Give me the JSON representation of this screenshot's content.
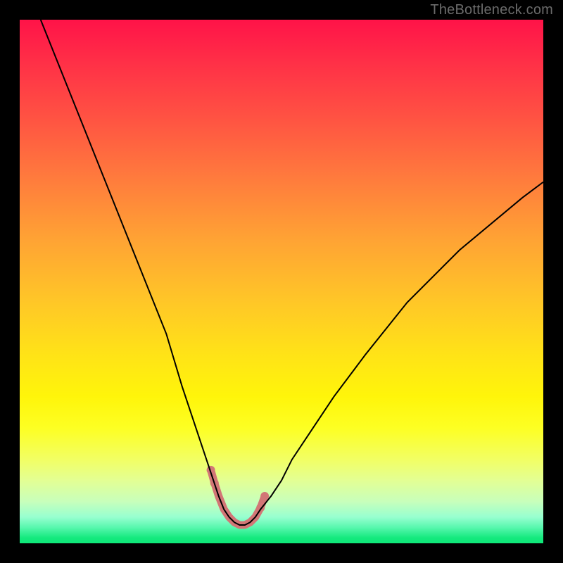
{
  "watermark": "TheBottleneck.com",
  "chart_data": {
    "type": "line",
    "title": "",
    "xlabel": "",
    "ylabel": "",
    "xlim": [
      0,
      100
    ],
    "ylim": [
      0,
      100
    ],
    "grid": false,
    "legend": false,
    "background_gradient_stops": [
      {
        "pct": 0,
        "color": "#ff1348"
      },
      {
        "pct": 8,
        "color": "#ff2f47"
      },
      {
        "pct": 18,
        "color": "#ff5043"
      },
      {
        "pct": 30,
        "color": "#ff7a3d"
      },
      {
        "pct": 42,
        "color": "#ffa334"
      },
      {
        "pct": 54,
        "color": "#ffc727"
      },
      {
        "pct": 64,
        "color": "#ffe317"
      },
      {
        "pct": 72,
        "color": "#fff50a"
      },
      {
        "pct": 78,
        "color": "#fdff23"
      },
      {
        "pct": 84,
        "color": "#f2ff64"
      },
      {
        "pct": 88,
        "color": "#e3ff94"
      },
      {
        "pct": 92,
        "color": "#c8ffbb"
      },
      {
        "pct": 95,
        "color": "#97ffd0"
      },
      {
        "pct": 97,
        "color": "#57f7ad"
      },
      {
        "pct": 99,
        "color": "#13e97d"
      },
      {
        "pct": 100,
        "color": "#0fe878"
      }
    ],
    "series": [
      {
        "name": "bottleneck-curve",
        "color": "#000000",
        "strokeWidth": 2,
        "x": [
          4,
          8,
          12,
          16,
          20,
          24,
          28,
          31,
          33,
          35,
          37,
          38,
          39,
          40,
          41,
          42,
          43,
          44,
          45,
          46,
          48,
          50,
          52,
          56,
          60,
          66,
          74,
          84,
          96,
          100
        ],
        "y": [
          100,
          90,
          80,
          70,
          60,
          50,
          40,
          30,
          24,
          18,
          12,
          9,
          6.5,
          5,
          4,
          3.5,
          3.5,
          4,
          5,
          6.5,
          9,
          12,
          16,
          22,
          28,
          36,
          46,
          56,
          66,
          69
        ]
      },
      {
        "name": "valley-highlight",
        "color": "#d27676",
        "strokeWidth": 11,
        "linecap": "round",
        "x": [
          36.5,
          37.2,
          38,
          39,
          40,
          41,
          42,
          43,
          44,
          45,
          46,
          46.8
        ],
        "y": [
          14,
          11.5,
          9,
          6.5,
          5,
          4,
          3.5,
          3.5,
          4,
          5,
          6.8,
          9
        ]
      }
    ],
    "markers": [
      {
        "x": 36.5,
        "y": 14,
        "r": 6,
        "color": "#d27676"
      },
      {
        "x": 37.2,
        "y": 11.5,
        "r": 6,
        "color": "#d27676"
      },
      {
        "x": 46.0,
        "y": 6.8,
        "r": 6,
        "color": "#d27676"
      },
      {
        "x": 46.8,
        "y": 9,
        "r": 6,
        "color": "#d27676"
      }
    ]
  }
}
